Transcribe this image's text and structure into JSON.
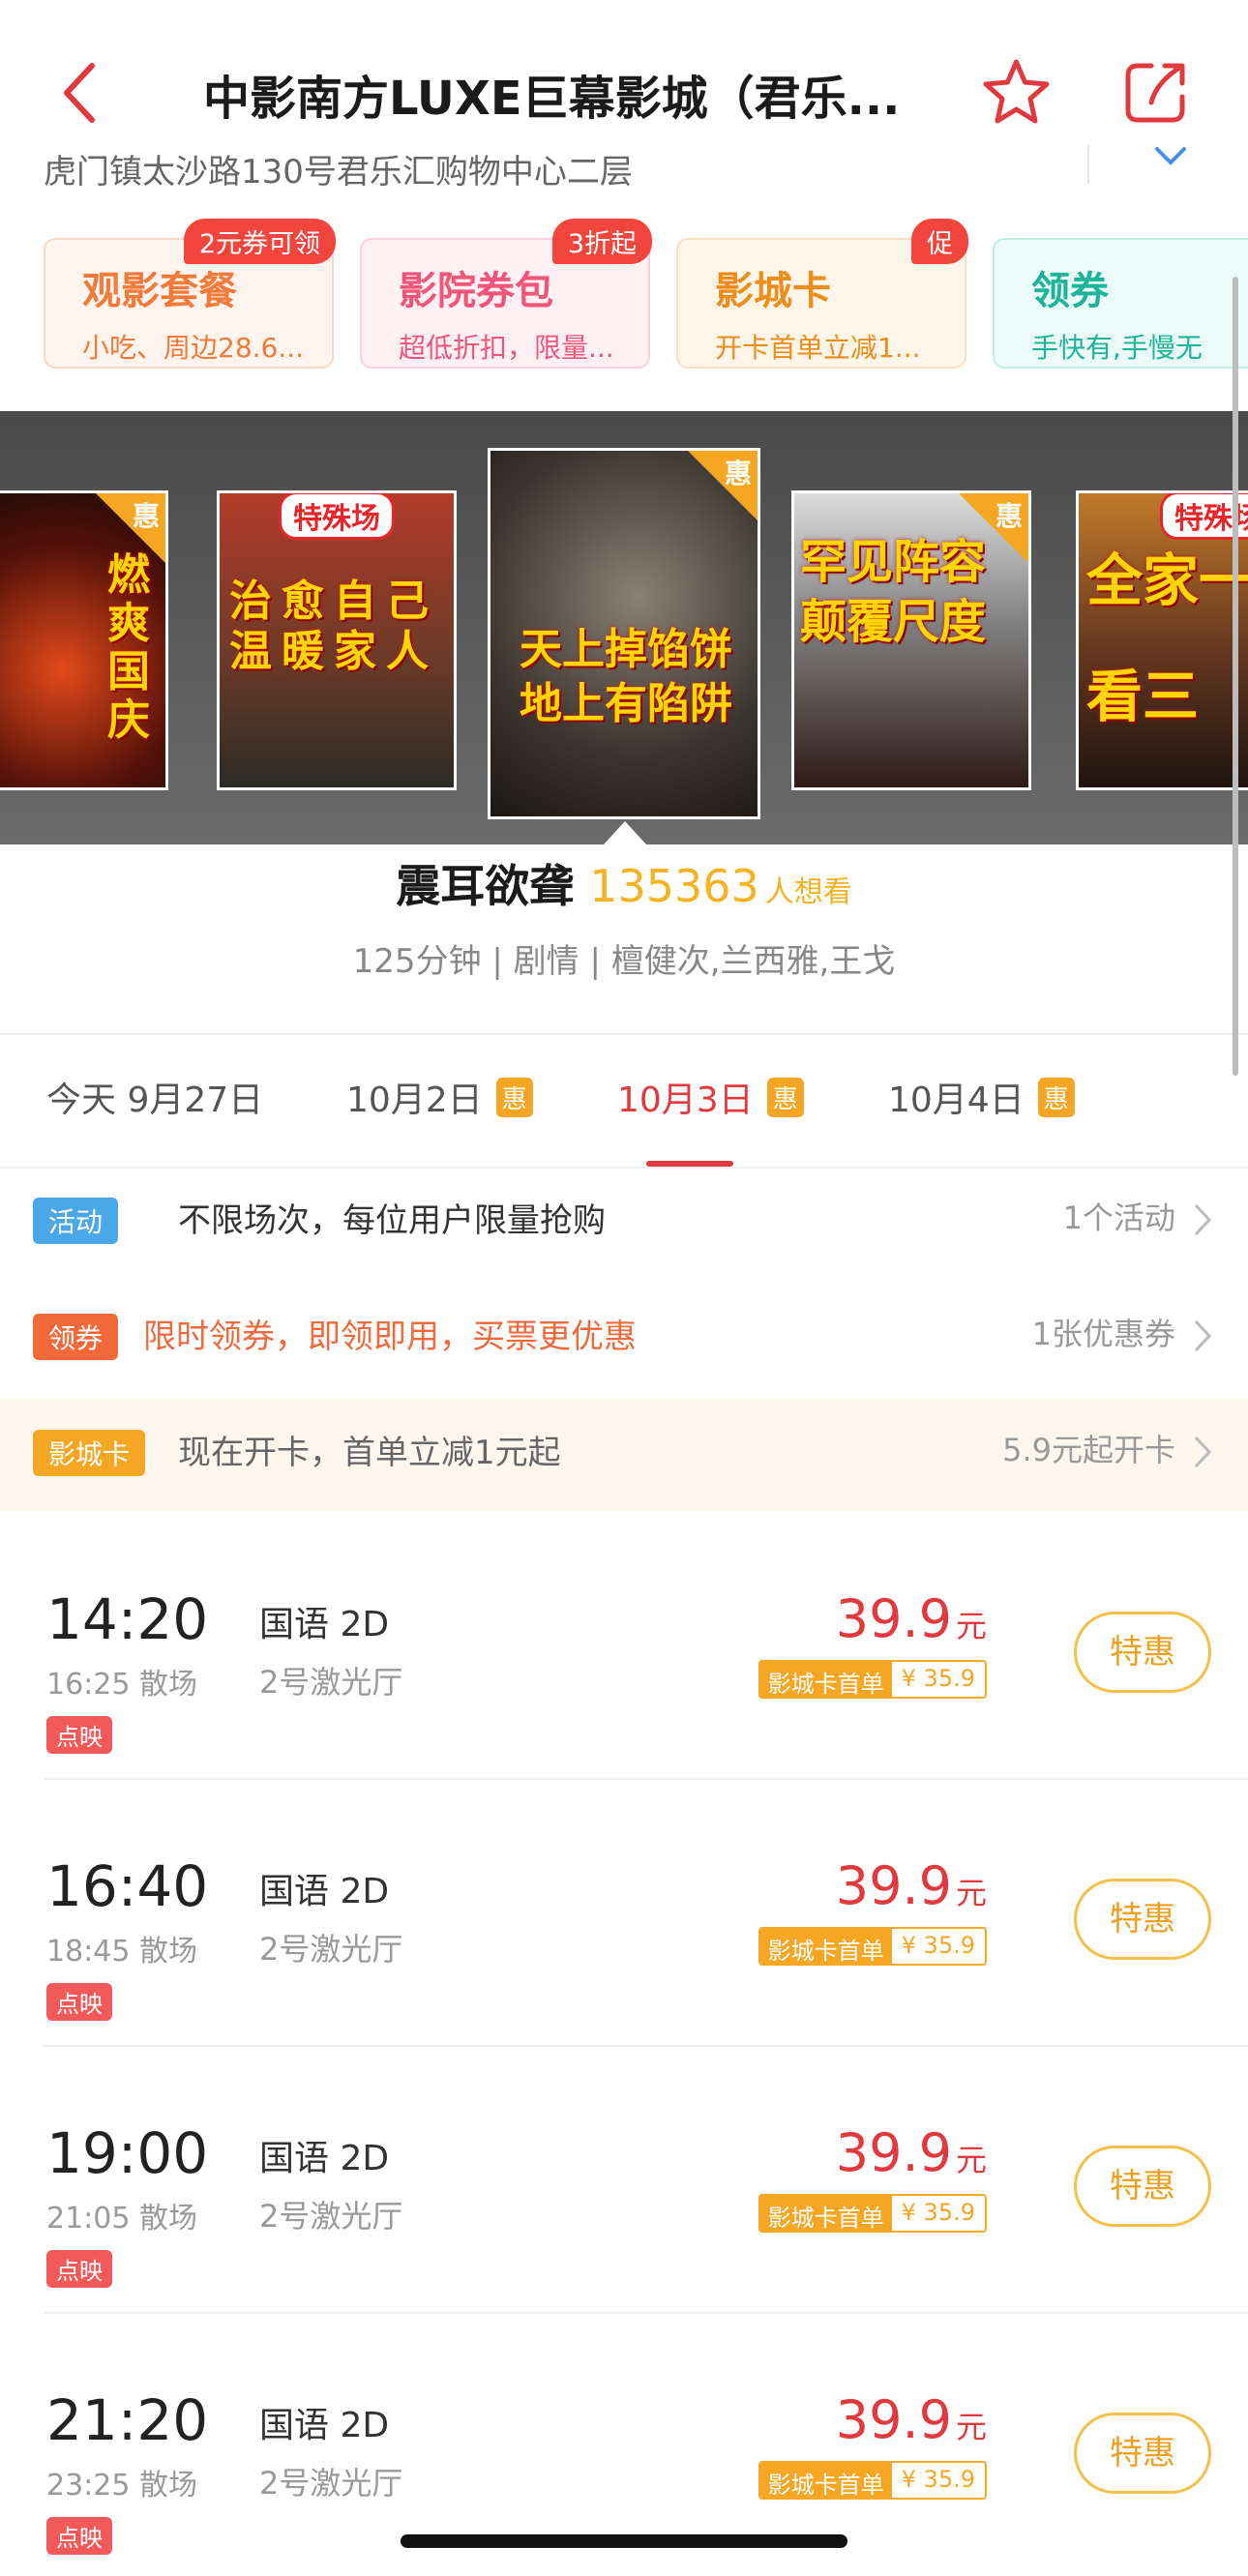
{
  "header": {
    "title": "中影南方LUXE巨幕影城（君乐...",
    "address": "虎门镇太沙路130号君乐汇购物中心二层"
  },
  "promos": [
    {
      "title": "观影套餐",
      "subtitle": "小吃、周边28.6...",
      "badge": "2元券可领"
    },
    {
      "title": "影院券包",
      "subtitle": "超低折扣，限量...",
      "badge": "3折起"
    },
    {
      "title": "影城卡",
      "subtitle": "开卡首单立减1...",
      "badge": "促"
    },
    {
      "title": "领券",
      "subtitle": "手快有,手慢无",
      "badge": ""
    }
  ],
  "posters": [
    {
      "corner": "惠",
      "text": "燃爽国庆",
      "special": ""
    },
    {
      "corner": "",
      "text": "治愈自己 温暖家人",
      "special": "特殊场"
    },
    {
      "corner": "惠",
      "text": "天上掉馅饼 地上有陷阱",
      "special": ""
    },
    {
      "corner": "惠",
      "text": "罕见阵容 颠覆尺度",
      "special": ""
    },
    {
      "corner": "",
      "text": "全家一 看三",
      "special": "特殊场"
    }
  ],
  "movie": {
    "name": "震耳欲聋",
    "want_count": "135363",
    "want_label": "人想看",
    "meta": "125分钟 | 剧情 | 檀健次,兰西雅,王戈"
  },
  "dates": [
    {
      "label": "今天 9月27日",
      "hui": ""
    },
    {
      "label": "10月2日",
      "hui": "惠"
    },
    {
      "label": "10月3日",
      "hui": "惠"
    },
    {
      "label": "10月4日",
      "hui": "惠"
    }
  ],
  "activity": {
    "badge": "活动",
    "text": "不限场次，每位用户限量抢购",
    "right": "1个活动"
  },
  "coupon": {
    "badge": "领券",
    "text": "限时领券，即领即用，买票更优惠",
    "right": "1张优惠券"
  },
  "card": {
    "badge": "影城卡",
    "text": "现在开卡，首单立减1元起",
    "right": "5.9元起开卡"
  },
  "showtimes": [
    {
      "start": "14:20",
      "end": "16:25 散场",
      "tag": "点映",
      "lang": "国语 2D",
      "hall": "2号激光厅",
      "price": "39.9",
      "unit": "元",
      "card_label": "影城卡首单",
      "card_price": "¥ 35.9",
      "button": "特惠"
    },
    {
      "start": "16:40",
      "end": "18:45 散场",
      "tag": "点映",
      "lang": "国语 2D",
      "hall": "2号激光厅",
      "price": "39.9",
      "unit": "元",
      "card_label": "影城卡首单",
      "card_price": "¥ 35.9",
      "button": "特惠"
    },
    {
      "start": "19:00",
      "end": "21:05 散场",
      "tag": "点映",
      "lang": "国语 2D",
      "hall": "2号激光厅",
      "price": "39.9",
      "unit": "元",
      "card_label": "影城卡首单",
      "card_price": "¥ 35.9",
      "button": "特惠"
    },
    {
      "start": "21:20",
      "end": "23:25 散场",
      "tag": "点映",
      "lang": "国语 2D",
      "hall": "2号激光厅",
      "price": "39.9",
      "unit": "元",
      "card_label": "影城卡首单",
      "card_price": "¥ 35.9",
      "button": "特惠"
    }
  ],
  "colors": {
    "accent": "#e0393e",
    "orange": "#f5a623",
    "want": "#f5b324"
  },
  "icons": [
    "back-icon",
    "star-icon",
    "share-icon",
    "chevron-down-icon",
    "chevron-right-icon"
  ]
}
